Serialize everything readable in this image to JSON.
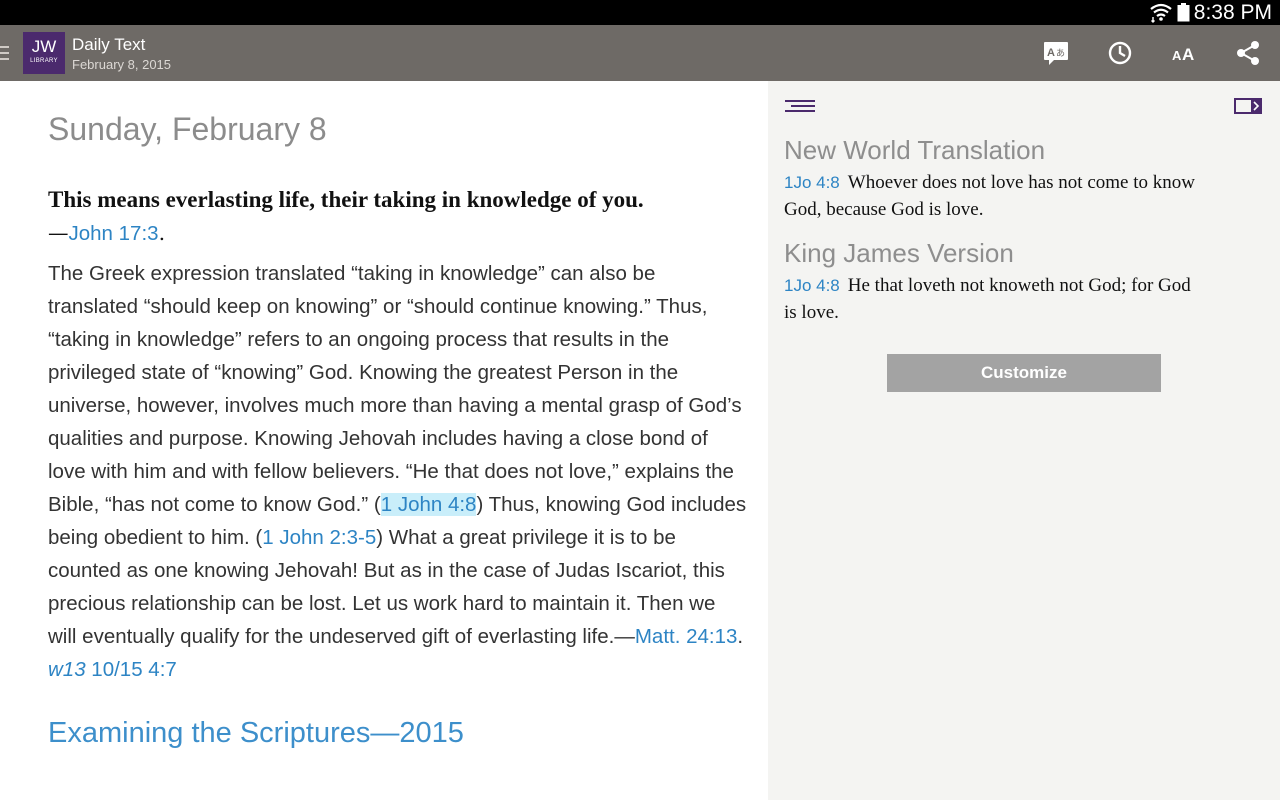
{
  "status_bar": {
    "time": "8:38 PM"
  },
  "action_bar": {
    "logo_line1": "JW",
    "logo_line2": "LIBRARY",
    "title": "Daily Text",
    "subtitle": "February 8, 2015",
    "icons": [
      "translate-icon",
      "history-icon",
      "text-size-icon",
      "share-icon"
    ]
  },
  "main": {
    "day_title": "Sunday, February 8",
    "theme_text": "This means everlasting life, their taking in knowledge of you.",
    "theme_dash": "—",
    "theme_ref": "John 17:3",
    "theme_end": ".",
    "body_p1": "The Greek expression translated “taking in knowledge” can also be translated “should keep on knowing” or “should continue knowing.” Thus, “taking in knowledge” refers to an ongoing process that results in the privileged state of “knowing” God. Knowing the greatest Person in the universe, however, involves much more than having a mental grasp of God’s qualities and purpose. Knowing Jehovah includes having a close bond of love with him and with fellow believers. “He that does not love,” explains the Bible, “has not come to know God.” (",
    "body_ref1": "1 John 4:8",
    "body_p2": ") Thus, knowing God includes being obedient to him. (",
    "body_ref2": "1 John 2:3-5",
    "body_p3": ") What a great privilege it is to be counted as one knowing Jehovah! But as in the case of Judas Iscariot, this precious relationship can be lost. Let us work hard to maintain it. Then we will eventually qualify for the undeserved gift of everlasting life.—",
    "body_ref3": "Matt. 24:13",
    "body_sep": ". ",
    "body_ref4_ital": "w13",
    "body_ref4_rest": " 10/15 4:7",
    "footer_link": "Examining the Scriptures—2015"
  },
  "side_panel": {
    "translations": [
      {
        "name": "New World Translation",
        "ref": "1Jo 4:8",
        "text": "Whoever does not love has not come to know God, because God is love."
      },
      {
        "name": "King James Version",
        "ref": "1Jo 4:8",
        "text": "He that loveth not knoweth not God; for God is love."
      }
    ],
    "customize_label": "Customize"
  },
  "colors": {
    "action_bar": "#6e6a66",
    "logo": "#4b2a6d",
    "link": "#2d84c4",
    "highlight": "#c9eefa",
    "side_bg": "#f4f4f2",
    "button": "#a3a3a3"
  }
}
